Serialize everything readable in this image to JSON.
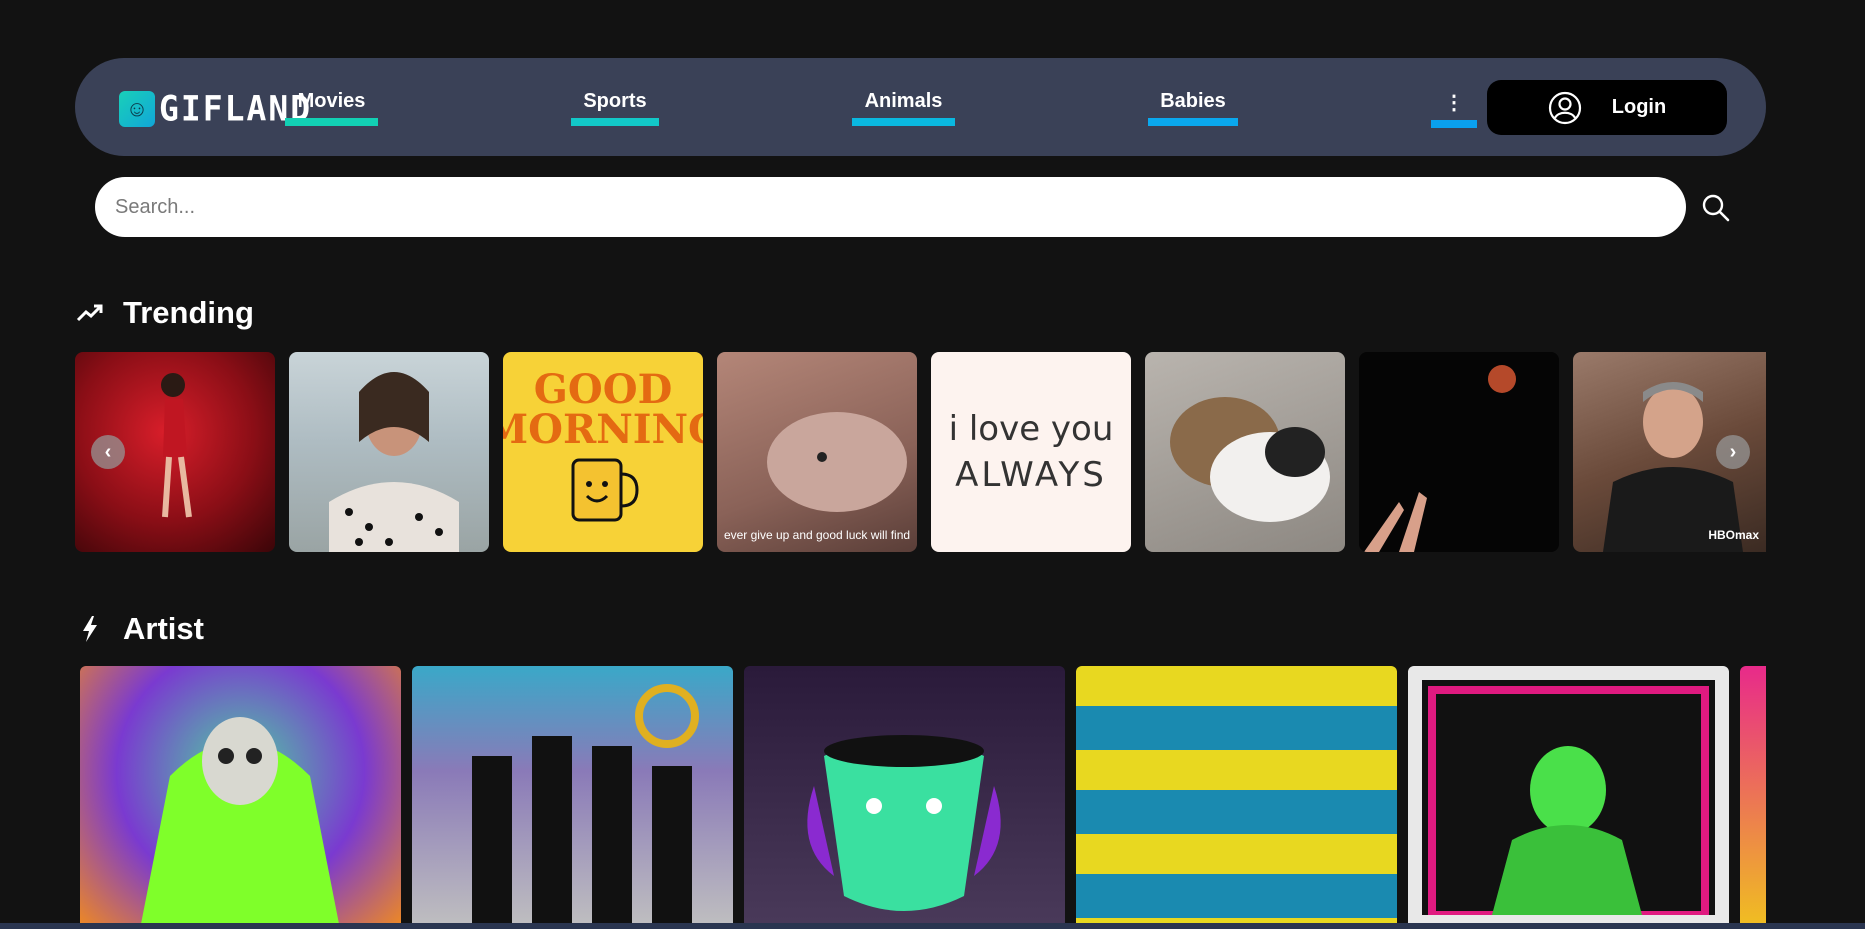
{
  "brand": {
    "logo_text": "GIFLAND"
  },
  "nav": {
    "items": [
      {
        "label": "Movies",
        "color": "#12d0b4"
      },
      {
        "label": "Sports",
        "color": "#12c8c8"
      },
      {
        "label": "Animals",
        "color": "#0ab8e0"
      },
      {
        "label": "Babies",
        "color": "#0aa8ee"
      }
    ],
    "more_label": "⋮",
    "login_label": "Login"
  },
  "search": {
    "placeholder": "Search..."
  },
  "sections": {
    "trending_title": "Trending",
    "artist_title": "Artist"
  },
  "trending": {
    "captions": {
      "tile4": "ever give up and good luck will find",
      "tile8": "HBOmax"
    },
    "good_morning_text": "GOOD MORNING",
    "love_line1": "i love you",
    "love_line2": "ALWAYS",
    "prev_label": "‹",
    "next_label": "›"
  }
}
